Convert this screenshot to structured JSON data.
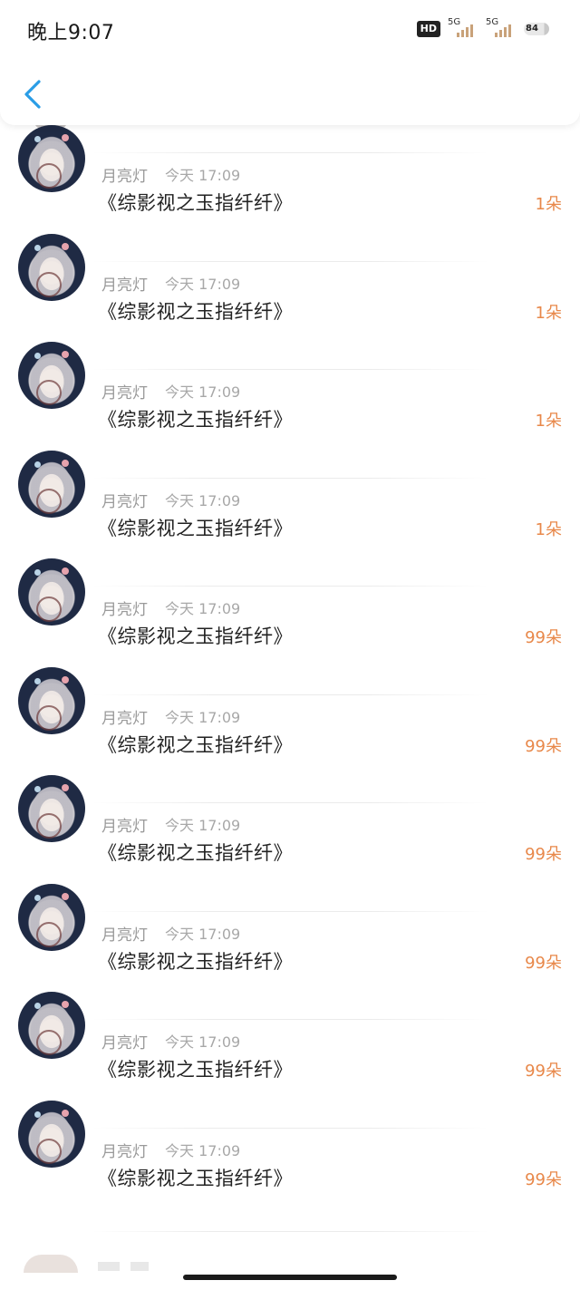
{
  "status_bar": {
    "time": "晚上9:07",
    "hd_label": "HD",
    "network1": "5G",
    "network2": "5G",
    "battery": "84"
  },
  "header": {
    "back_icon": "chevron-left-icon",
    "accent_color": "#2a9de6"
  },
  "colors": {
    "amount": "#e8884a",
    "name": "#9a9a9a"
  },
  "gifts": [
    {
      "user": "月亮灯",
      "time": "今天 17:09",
      "title": "《综影视之玉指纤纤》",
      "amount": "1朵"
    },
    {
      "user": "月亮灯",
      "time": "今天 17:09",
      "title": "《综影视之玉指纤纤》",
      "amount": "1朵"
    },
    {
      "user": "月亮灯",
      "time": "今天 17:09",
      "title": "《综影视之玉指纤纤》",
      "amount": "1朵"
    },
    {
      "user": "月亮灯",
      "time": "今天 17:09",
      "title": "《综影视之玉指纤纤》",
      "amount": "1朵"
    },
    {
      "user": "月亮灯",
      "time": "今天 17:09",
      "title": "《综影视之玉指纤纤》",
      "amount": "99朵"
    },
    {
      "user": "月亮灯",
      "time": "今天 17:09",
      "title": "《综影视之玉指纤纤》",
      "amount": "99朵"
    },
    {
      "user": "月亮灯",
      "time": "今天 17:09",
      "title": "《综影视之玉指纤纤》",
      "amount": "99朵"
    },
    {
      "user": "月亮灯",
      "time": "今天 17:09",
      "title": "《综影视之玉指纤纤》",
      "amount": "99朵"
    },
    {
      "user": "月亮灯",
      "time": "今天 17:09",
      "title": "《综影视之玉指纤纤》",
      "amount": "99朵"
    },
    {
      "user": "月亮灯",
      "time": "今天 17:09",
      "title": "《综影视之玉指纤纤》",
      "amount": "99朵"
    }
  ]
}
